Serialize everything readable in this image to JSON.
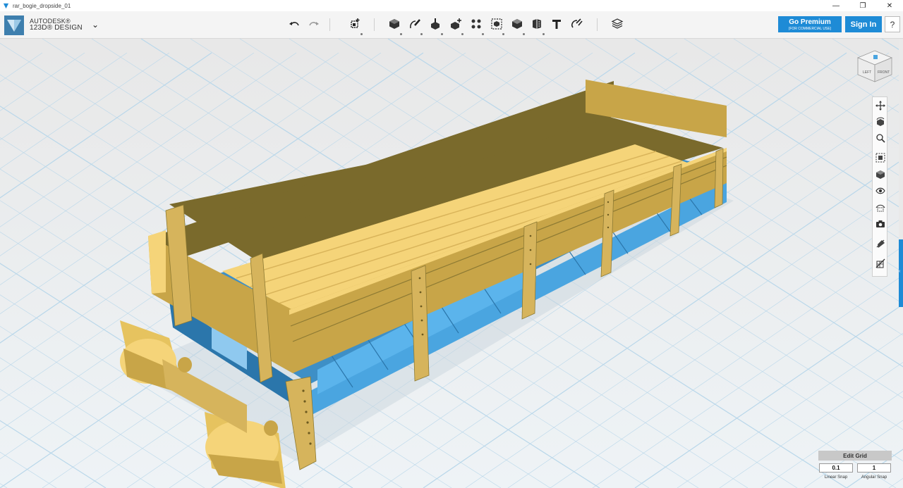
{
  "window": {
    "title": "rar_bogie_dropside_01",
    "controls": {
      "minimize": "—",
      "maximize": "❐",
      "close": "✕"
    }
  },
  "brand": {
    "company": "AUTODESK®",
    "product": "123D® DESIGN",
    "menu_icon": "chevron-down-icon",
    "accent_color": "#1e8bd6"
  },
  "toolbar": {
    "tools": [
      "undo-icon",
      "redo-icon",
      "transform-icon",
      "primitives-icon",
      "sketch-icon",
      "construct-icon",
      "modify-icon",
      "pattern-icon",
      "grouping-icon",
      "combine-icon",
      "measure-icon",
      "text-icon",
      "snap-icon",
      "material-icon"
    ],
    "premium_label": "Go Premium",
    "premium_sublabel": "(FOR COMMERCIAL USE)",
    "signin_label": "Sign In",
    "help_label": "?"
  },
  "viewcube": {
    "left_label": "LEFT",
    "front_label": "FRONT"
  },
  "navbar": {
    "tools": [
      "pan-icon",
      "orbit-icon",
      "zoom-icon",
      "fit-icon",
      "view-cube-icon",
      "visibility-icon",
      "materials-outline-icon",
      "camera-icon",
      "hide-sketch-icon",
      "hide-mesh-icon"
    ]
  },
  "grid_panel": {
    "edit_label": "Edit Grid",
    "linear_snap_value": "0.1",
    "angular_snap_value": "1",
    "linear_snap_label": "Linear Snap",
    "angular_snap_label": "Angular Snap"
  },
  "colors": {
    "wood_top": "#f5d479",
    "wood_side": "#c8a548",
    "wood_dark": "#7a6a2c",
    "chassis": "#4aa5e0",
    "grid_line": "#b9d7ea"
  }
}
